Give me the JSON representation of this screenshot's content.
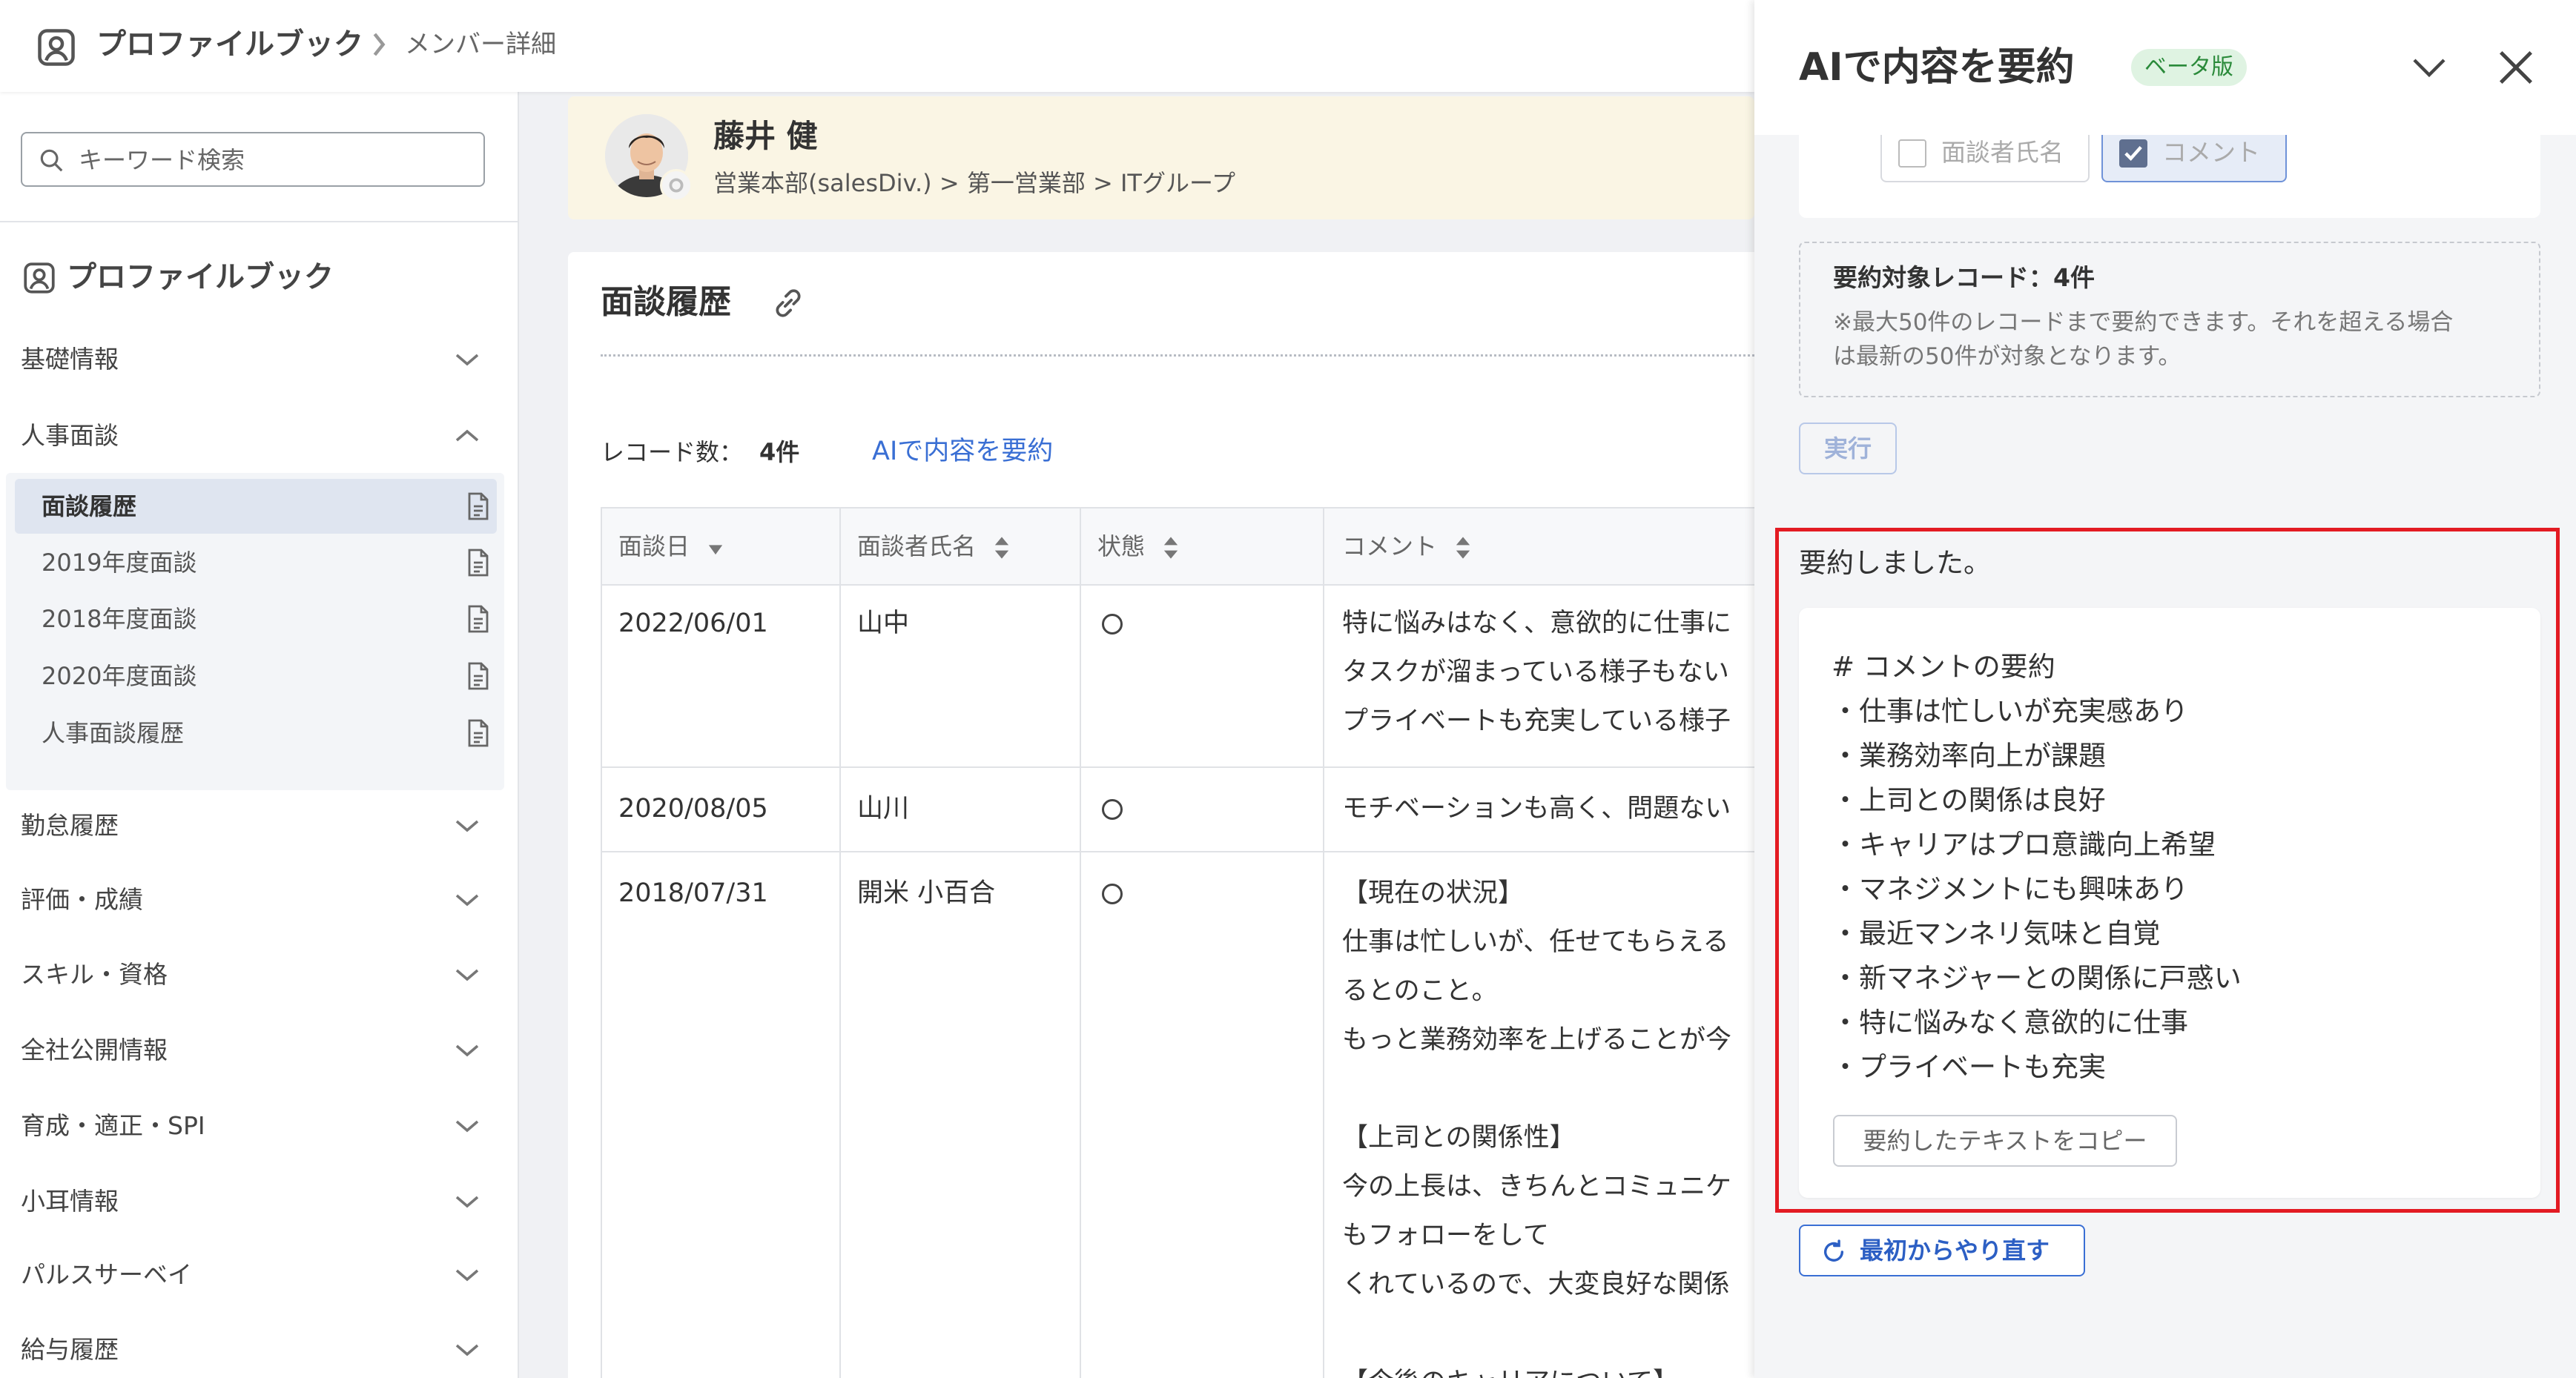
{
  "topbar": {
    "app_name": "プロファイルブック",
    "breadcrumb_current": "メンバー詳細"
  },
  "sidebar": {
    "search_placeholder": "キーワード検索",
    "header": "プロファイルブック",
    "items": [
      {
        "label": "基礎情報",
        "expanded": false
      },
      {
        "label": "人事面談",
        "expanded": true
      },
      {
        "label": "勤怠履歴",
        "expanded": false
      },
      {
        "label": "評価・成績",
        "expanded": false
      },
      {
        "label": "スキル・資格",
        "expanded": false
      },
      {
        "label": "全社公開情報",
        "expanded": false
      },
      {
        "label": "育成・適正・SPI",
        "expanded": false
      },
      {
        "label": "小耳情報",
        "expanded": false
      },
      {
        "label": "パルスサーベイ",
        "expanded": false
      },
      {
        "label": "給与履歴",
        "expanded": false
      }
    ],
    "sub_items": [
      {
        "label": "面談履歴",
        "active": true
      },
      {
        "label": "2019年度面談",
        "active": false
      },
      {
        "label": "2018年度面談",
        "active": false
      },
      {
        "label": "2020年度面談",
        "active": false
      },
      {
        "label": "人事面談履歴",
        "active": false
      }
    ]
  },
  "profile": {
    "name": "藤井 健",
    "department": "営業本部(salesDiv.) > 第一営業部 > ITグループ"
  },
  "section": {
    "title": "面談履歴",
    "record_count_label": "レコード数：",
    "record_count_value": "4件",
    "ai_link": "AIで内容を要約"
  },
  "table": {
    "columns": [
      "面談日",
      "面談者氏名",
      "状態",
      "コメント"
    ],
    "rows": [
      {
        "date": "2022/06/01",
        "interviewer": "山中",
        "status": "○",
        "comment": [
          "特に悩みはなく、意欲的に仕事に",
          "タスクが溜まっている様子もない",
          "プライベートも充実している様子"
        ]
      },
      {
        "date": "2020/08/05",
        "interviewer": "山川",
        "status": "○",
        "comment": [
          "モチベーションも高く、問題ない"
        ]
      },
      {
        "date": "2018/07/31",
        "interviewer": "開米 小百合",
        "status": "○",
        "comment": [
          "【現在の状況】",
          "仕事は忙しいが、任せてもらえる",
          "るとのこと。",
          "もっと業務効率を上げることが今",
          "",
          "【上司との関係性】",
          "今の上長は、きちんとコミュニケ",
          "もフォローをして",
          "くれているので、大変良好な関係",
          "",
          "【今後のキャリアについて】"
        ]
      }
    ]
  },
  "ai_panel": {
    "title": "AIで内容を要約",
    "badge": "ベータ版",
    "options": [
      {
        "label": "面談者氏名",
        "checked": false
      },
      {
        "label": "コメント",
        "checked": true
      }
    ],
    "info_title": "要約対象レコード：4件",
    "info_note": [
      "※最大50件のレコードまで要約できます。それを超える場合",
      "は最新の50件が対象となります。"
    ],
    "run_label": "実行",
    "done_text": "要約しました。",
    "summary_heading": "# コメントの要約",
    "summary_lines": [
      "・仕事は忙しいが充実感あり",
      "・業務効率向上が課題",
      "・上司との関係は良好",
      "・キャリアはプロ意識向上希望",
      "・マネジメントにも興味あり",
      "・最近マンネリ気味と自覚",
      "・新マネジャーとの関係に戸惑い",
      "・特に悩みなく意欲的に仕事",
      "・プライベートも充実"
    ],
    "copy_label": "要約したテキストをコピー",
    "restart_label": "最初からやり直す"
  },
  "colors": {
    "accent": "#3a6fd4",
    "highlight": "#e31b23",
    "badge_text": "#2a8a3a",
    "badge_bg": "#dff3e2",
    "profile_bg": "#faf5e4"
  }
}
